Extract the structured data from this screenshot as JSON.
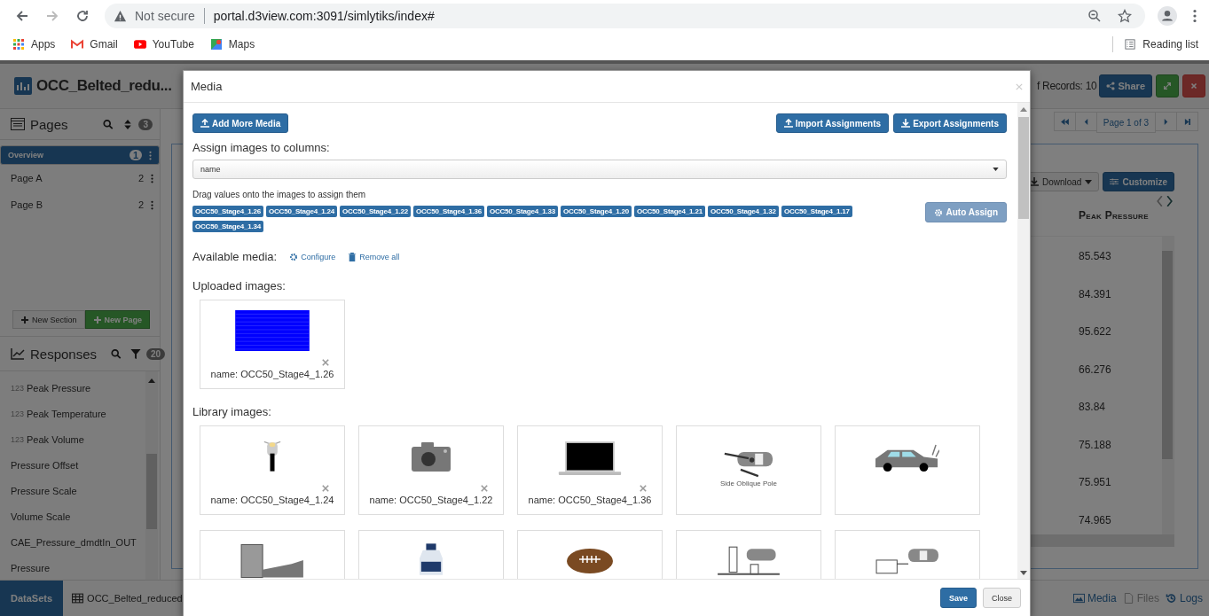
{
  "browser": {
    "security": "Not secure",
    "url": "portal.d3view.com:3091/simlytiks/index#",
    "bookmarks": [
      "Apps",
      "Gmail",
      "YouTube",
      "Maps"
    ],
    "reading_list": "Reading list"
  },
  "app": {
    "title": "OCC_Belted_redu...",
    "records": "f Records: 10",
    "share": "Share",
    "pages": {
      "title": "Pages",
      "count": "3",
      "items": [
        {
          "label": "Overview",
          "count": "1",
          "selected": true
        },
        {
          "label": "Page A",
          "count": "2",
          "selected": false
        },
        {
          "label": "Page B",
          "count": "2",
          "selected": false
        }
      ]
    },
    "new_section": "New Section",
    "new_page": "New Page",
    "responses": {
      "title": "Responses",
      "count": "20",
      "items": [
        {
          "label": "Peak Pressure",
          "type_label": "123"
        },
        {
          "label": "Peak Temperature",
          "type_label": "123"
        },
        {
          "label": "Peak Volume",
          "type_label": "123"
        },
        {
          "label": "Pressure Offset"
        },
        {
          "label": "Pressure Scale"
        },
        {
          "label": "Volume Scale"
        },
        {
          "label": "CAE_Pressure_dmdtIn_OUT"
        },
        {
          "label": "Pressure"
        }
      ]
    },
    "pagination": "Page 1 of 3",
    "download": "Download",
    "customize": "Customize",
    "table": {
      "column": "Peak Pressure",
      "values": [
        "85.543",
        "84.391",
        "95.622",
        "66.276",
        "83.84",
        "75.188",
        "75.951",
        "74.965"
      ]
    },
    "bottom": {
      "datasets": "DataSets",
      "dataset_tab": "OCC_Belted_reduced",
      "links": [
        {
          "label": "Media",
          "kind": "image"
        },
        {
          "label": "Files",
          "kind": "file"
        },
        {
          "label": "Logs",
          "kind": "history"
        }
      ]
    }
  },
  "modal": {
    "title": "Media",
    "add_more": "Add More Media",
    "import": "Import Assignments",
    "export": "Export Assignments",
    "assign_label": "Assign images to columns:",
    "column_select": "name",
    "drag_hint": "Drag values onto the images to assign them",
    "tags": [
      "OCC50_Stage4_1.26",
      "OCC50_Stage4_1.24",
      "OCC50_Stage4_1.22",
      "OCC50_Stage4_1.36",
      "OCC50_Stage4_1.33",
      "OCC50_Stage4_1.20",
      "OCC50_Stage4_1.21",
      "OCC50_Stage4_1.32",
      "OCC50_Stage4_1.17",
      "OCC50_Stage4_1.34"
    ],
    "auto_assign": "Auto Assign",
    "available_label": "Available media:",
    "configure": "Configure",
    "remove_all": "Remove all",
    "uploaded_label": "Uploaded images:",
    "uploaded": [
      {
        "kind": "chart",
        "caption": "name: OCC50_Stage4_1.26"
      }
    ],
    "library_label": "Library images:",
    "library": [
      {
        "kind": "motorcycle",
        "caption": "name: OCC50_Stage4_1.24"
      },
      {
        "kind": "camera",
        "caption": "name: OCC50_Stage4_1.22"
      },
      {
        "kind": "laptop",
        "caption": "name: OCC50_Stage4_1.36"
      },
      {
        "kind": "pole-test",
        "caption_small": "Side Oblique Pole"
      },
      {
        "kind": "car"
      },
      {
        "kind": "barrier"
      },
      {
        "kind": "bottle"
      },
      {
        "kind": "football"
      },
      {
        "kind": "rig"
      },
      {
        "kind": "sled"
      }
    ],
    "save": "Save",
    "close": "Close"
  }
}
